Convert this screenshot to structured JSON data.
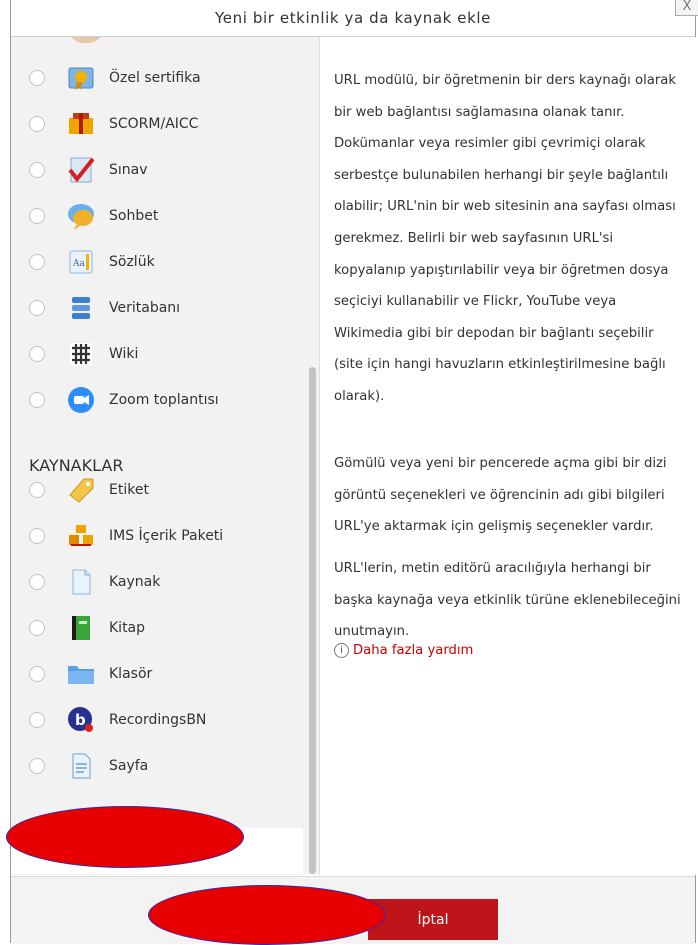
{
  "dialog": {
    "title": "Yeni bir etkinlik ya da kaynak ekle",
    "close_label": "X"
  },
  "activities": [
    {
      "label": "Özel sertifika",
      "icon": "certificate-icon"
    },
    {
      "label": "SCORM/AICC",
      "icon": "scorm-icon"
    },
    {
      "label": "Sınav",
      "icon": "quiz-icon"
    },
    {
      "label": "Sohbet",
      "icon": "chat-icon"
    },
    {
      "label": "Sözlük",
      "icon": "glossary-icon"
    },
    {
      "label": "Veritabanı",
      "icon": "database-icon"
    },
    {
      "label": "Wiki",
      "icon": "wiki-icon"
    },
    {
      "label": "Zoom toplantısı",
      "icon": "zoom-icon"
    }
  ],
  "resources_heading": "KAYNAKLAR",
  "resources": [
    {
      "label": "Etiket",
      "icon": "label-icon"
    },
    {
      "label": "IMS İçerik Paketi",
      "icon": "ims-package-icon"
    },
    {
      "label": "Kaynak",
      "icon": "file-icon"
    },
    {
      "label": "Kitap",
      "icon": "book-icon"
    },
    {
      "label": "Klasör",
      "icon": "folder-icon"
    },
    {
      "label": "RecordingsBN",
      "icon": "recordingsbn-icon"
    },
    {
      "label": "Sayfa",
      "icon": "page-icon"
    }
  ],
  "help": {
    "paragraphs": [
      "URL modülü, bir öğretmenin bir ders kaynağı olarak bir web bağlantısı sağlamasına olanak tanır. Dokümanlar veya resimler gibi çevrimiçi olarak serbestçe bulunabilen herhangi bir şeyle bağlantılı olabilir; URL'nin bir web sitesinin ana sayfası olması gerekmez. Belirli bir web sayfasının URL'si kopyalanıp yapıştırılabilir veya bir öğretmen dosya seçiciyi kullanabilir ve Flickr, YouTube veya Wikimedia gibi bir depodan bir bağlantı seçebilir (site için hangi havuzların etkinleştirilmesine bağlı olarak).",
      "Gömülü veya yeni bir pencerede açma gibi bir dizi görüntü seçenekleri ve öğrencinin adı gibi bilgileri URL'ye aktarmak için gelişmiş seçenekler vardır.",
      "URL'lerin, metin editörü aracılığıyla herhangi bir başka kaynağa veya etkinlik türüne eklenebileceğini unutmayın."
    ],
    "more_help": "Daha fazla yardım"
  },
  "footer": {
    "cancel_label": "İptal"
  },
  "colors": {
    "accent": "#c0141b",
    "link": "#cc0000"
  }
}
